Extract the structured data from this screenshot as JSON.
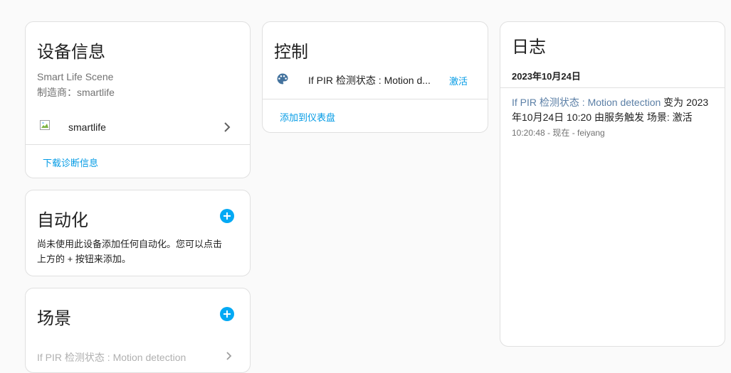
{
  "device_info": {
    "title": "设备信息",
    "model": "Smart Life Scene",
    "manufacturer": "制造商：smartlife",
    "integration": "smartlife",
    "download": "下载诊断信息"
  },
  "automation": {
    "title": "自动化",
    "description_line1": "尚未使用此设备添加任何自动化。您可以点击",
    "description_line2": "上方的 + 按钮来添加。"
  },
  "scenes": {
    "title": "场景",
    "item": "If PIR 检测状态 : Motion detection"
  },
  "controls": {
    "title": "控制",
    "entity_name": "If PIR 检测状态 : Motion d...",
    "activate": "激活",
    "add_to_dashboard": "添加到仪表盘"
  },
  "logbook": {
    "title": "日志",
    "date": "2023年10月24日",
    "entry_entity": "If PIR 检测状态 : Motion detection",
    "entry_text_1": " 变为 2023",
    "entry_text_2": "年10月24日 10:20 由服务触发 场景: 激活",
    "entry_meta": "10:20:48 - 现在 - feiyang"
  },
  "colors": {
    "accent": "#03a9f4",
    "link": "#039be5",
    "entity_link": "#5b7fa6",
    "palette_icon": "#44739e"
  },
  "icons": {
    "add": "plus-circle-icon",
    "chevron": "chevron-right-icon",
    "scene": "palette-icon",
    "integration": "broken-image-icon"
  }
}
